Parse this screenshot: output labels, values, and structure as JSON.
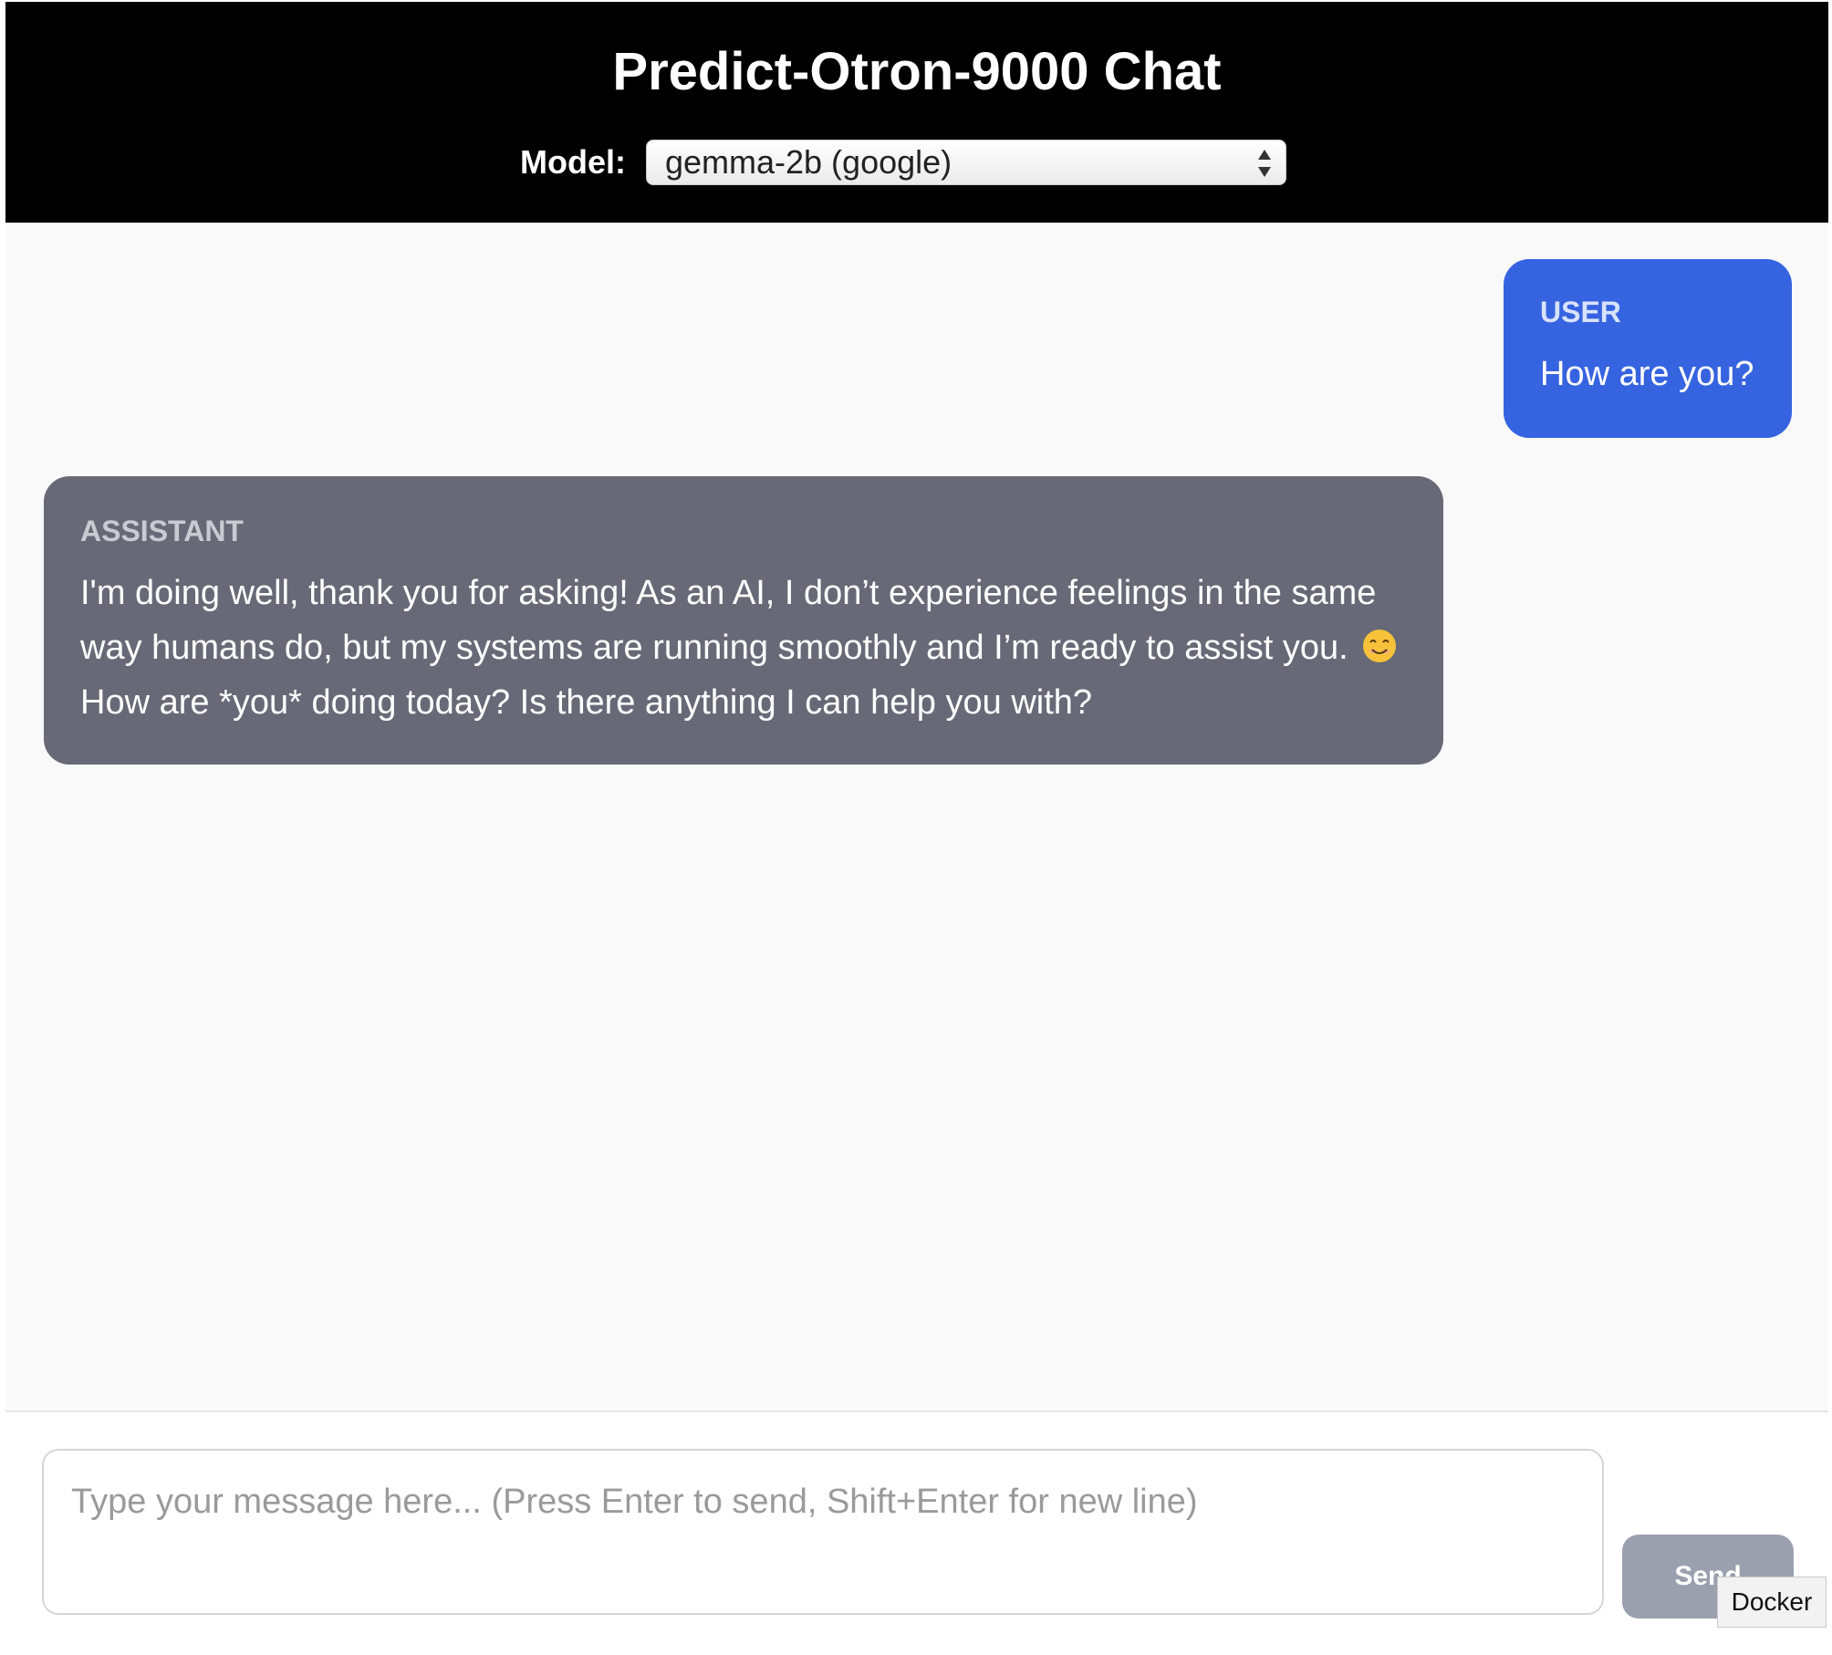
{
  "header": {
    "title": "Predict-Otron-9000 Chat",
    "model_label": "Model:",
    "model_selected": "gemma-2b (google)"
  },
  "messages": [
    {
      "role": "USER",
      "text": "How are you?"
    },
    {
      "role": "ASSISTANT",
      "text_part1": "I'm doing well, thank you for asking! As an AI, I don’t experience feelings in the same way humans do, but my systems are running smoothly and I’m ready to assist you.",
      "emoji": "smiling-face-icon",
      "text_part2": "How are *you* doing today? Is there anything I can help you with?"
    }
  ],
  "composer": {
    "placeholder": "Type your message here... (Press Enter to send, Shift+Enter for new line)",
    "value": "",
    "send_label": "Send"
  },
  "tooltip": {
    "text": "Docker"
  },
  "colors": {
    "header_bg": "#000000",
    "user_bubble": "#3663e0",
    "assistant_bubble": "#676a76",
    "send_disabled": "#9aa0ae",
    "chat_bg": "#f9f9f9"
  }
}
